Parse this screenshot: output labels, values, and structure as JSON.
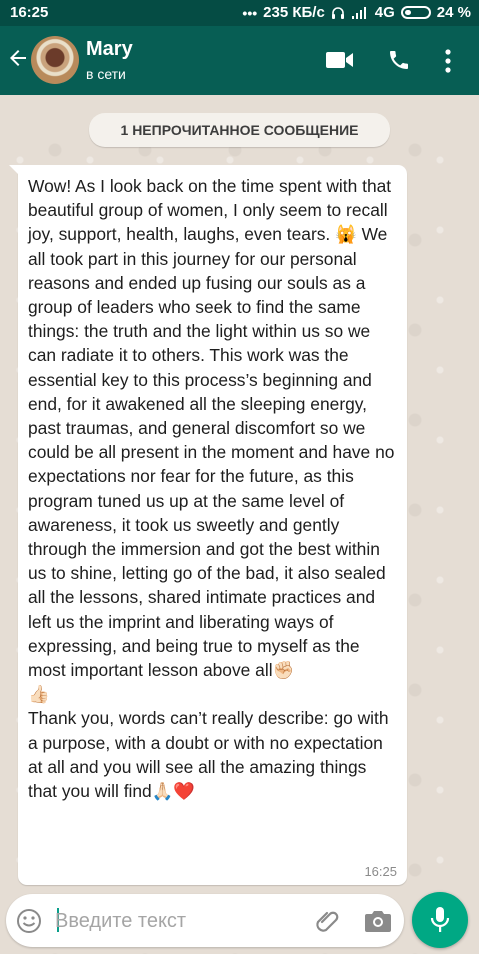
{
  "status_bar": {
    "time": "16:25",
    "network_speed": "235 КБ/с",
    "network_type": "4G",
    "battery": "24 %"
  },
  "header": {
    "contact_name": "Mary",
    "contact_status": "в сети",
    "icons": [
      "back-arrow-icon",
      "video-call-icon",
      "phone-icon",
      "more-vert-icon"
    ]
  },
  "unread_label": "1 НЕПРОЧИТАННОЕ СООБЩЕНИЕ",
  "message": {
    "text": "Wow! As I look back on the time spent with that beautiful group of women, I only seem to recall joy, support, health, laughs, even tears. 🙀 We all took part in this journey for our personal reasons and ended up fusing our souls as a group of leaders who seek to find the same things: the truth and the light within us so we can radiate it to others. This work was the essential key to this process’s beginning and end, for it awakened all the sleeping energy, past traumas, and general discomfort so we could be all present in the moment and have no expectations nor fear for the future, as this program tuned us up at the same level of awareness, it took us sweetly and gently through the immersion and got the best within us to shine, letting go of the bad, it also sealed all the lessons, shared intimate practices and left us the imprint and liberating ways of expressing, and being true to myself as the most important lesson above all✊🏻\n👍🏻\nThank you, words can’t really describe: go with a purpose, with a doubt or with no expectation at all and you will see all the amazing things that you will find🙏🏻❤️",
    "time": "16:25"
  },
  "input": {
    "placeholder": "Введите текст"
  },
  "colors": {
    "header": "#075e54",
    "status_bar": "#054c44",
    "accent": "#00a884",
    "wallpaper": "#e5ddd4"
  }
}
